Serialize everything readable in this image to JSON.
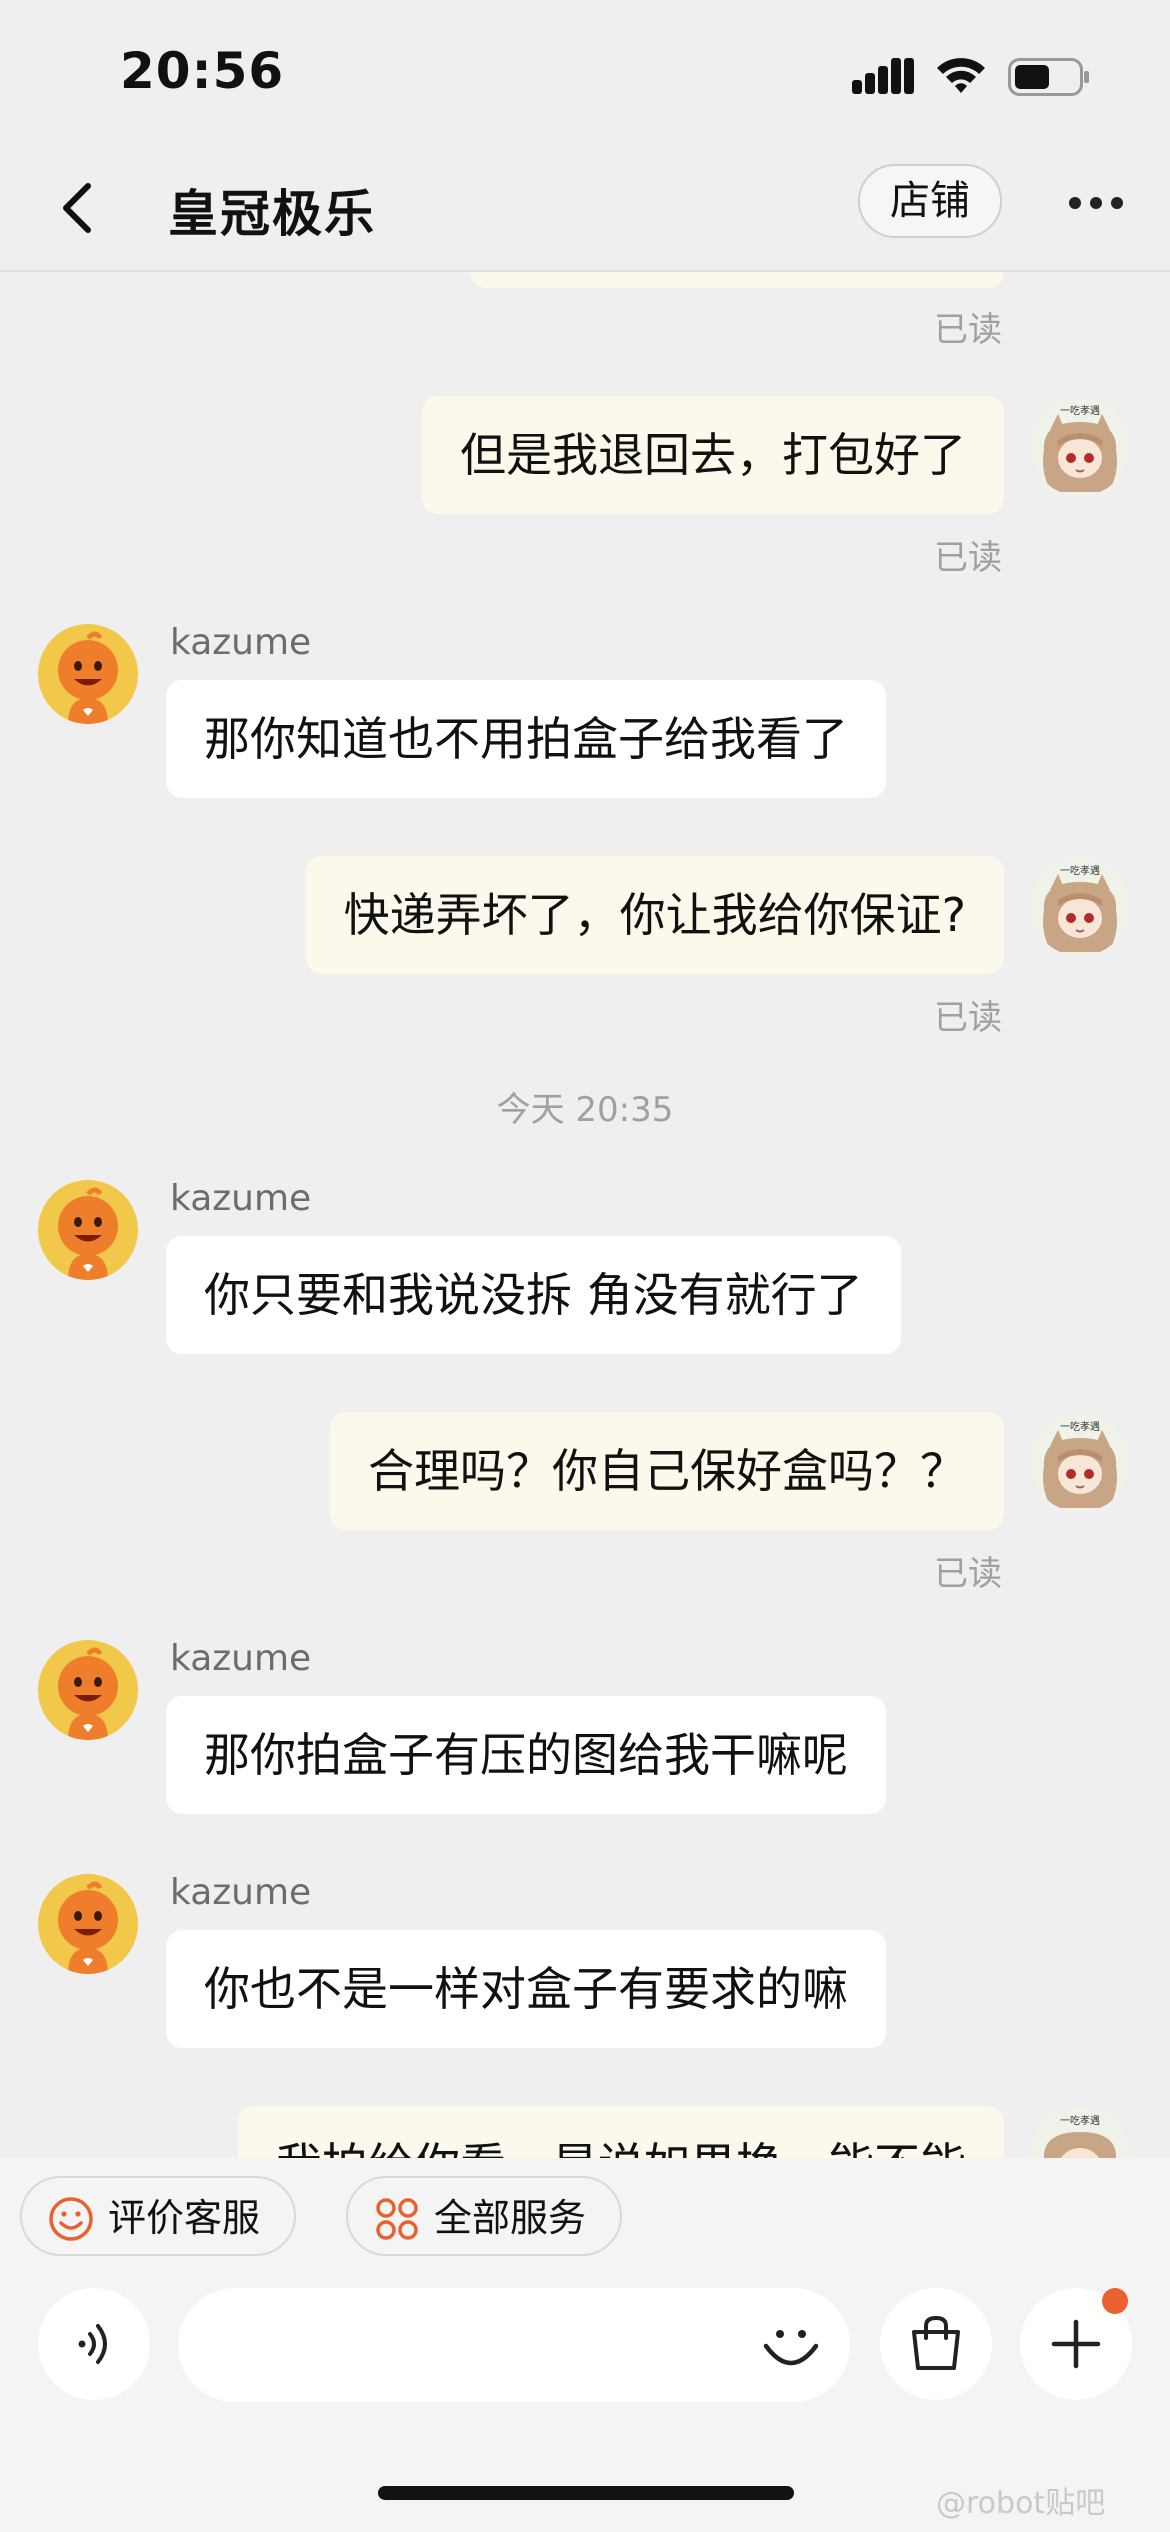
{
  "status_bar": {
    "time": "20:56"
  },
  "header": {
    "title": "皇冠极乐",
    "store_button": "店铺"
  },
  "chat": {
    "read_label": "已读",
    "timestamp": "今天 20:35",
    "messages": [
      {
        "from": "me",
        "text": "但是我退回去，打包好了"
      },
      {
        "from": "kazume",
        "sender": "kazume",
        "text": "那你知道也不用拍盒子给我看了"
      },
      {
        "from": "me",
        "text": "快递弄坏了，你让我给你保证?"
      },
      {
        "from": "kazume",
        "sender": "kazume",
        "text": "你只要和我说没拆 角没有就行了"
      },
      {
        "from": "me",
        "text": "合理吗？你自己保好盒吗？？"
      },
      {
        "from": "kazume",
        "sender": "kazume",
        "text": "那你拍盒子有压的图给我干嘛呢"
      },
      {
        "from": "kazume",
        "sender": "kazume",
        "text": "你也不是一样对盒子有要求的嘛"
      },
      {
        "from": "me",
        "text": "我拍给你看，是说如果换，能不能"
      }
    ]
  },
  "quick_actions": [
    {
      "label": "评价客服",
      "icon": "smile-icon"
    },
    {
      "label": "全部服务",
      "icon": "grid-services-icon"
    }
  ],
  "watermark": "@robot贴吧",
  "colors": {
    "background": "#efefef",
    "my_bubble": "#fcf8ec",
    "their_bubble": "#ffffff",
    "accent_orange": "#e8612f",
    "avatar_yellow": "#f1c84a"
  }
}
